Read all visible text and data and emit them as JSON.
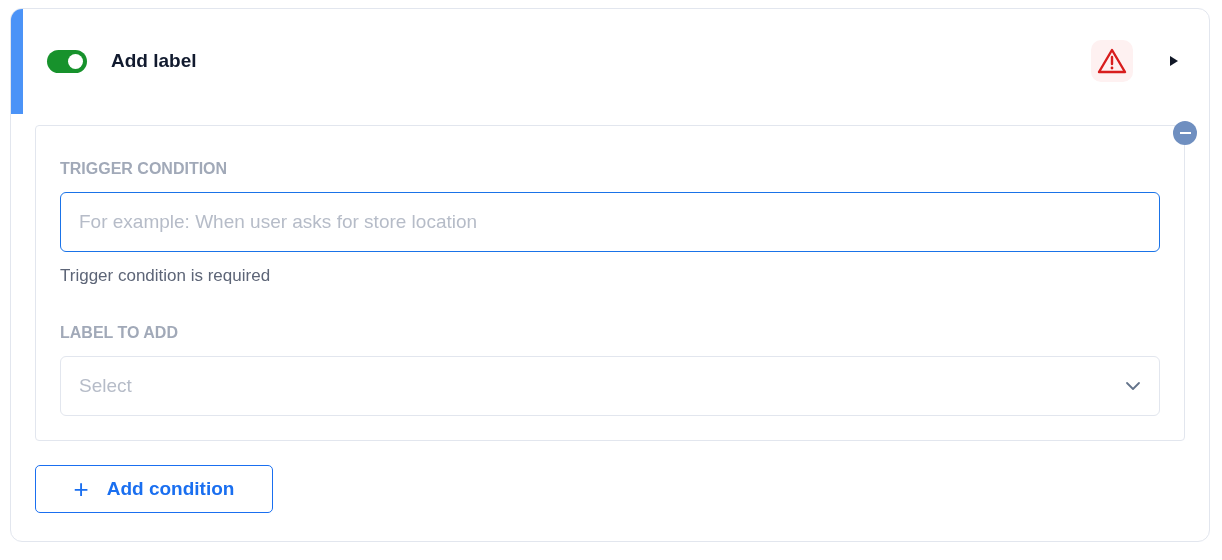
{
  "rule": {
    "enabled": true,
    "title": "Add label",
    "warning": true,
    "expanded": true
  },
  "condition": {
    "trigger_label": "TRIGGER CONDITION",
    "trigger_placeholder": "For example: When user asks for store location",
    "trigger_error": "Trigger condition is required",
    "label_label": "LABEL TO ADD",
    "label_placeholder": "Select"
  },
  "add_button": {
    "icon": "+",
    "label": "Add condition"
  }
}
